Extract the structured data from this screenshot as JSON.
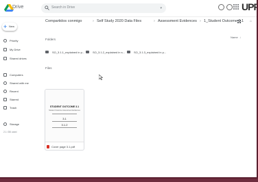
{
  "app": {
    "title": "Drive",
    "brand": "UPF"
  },
  "search": {
    "placeholder": "Search in Drive",
    "options": "▾"
  },
  "sidebar": {
    "new_label": "New",
    "items": [
      {
        "label": "Priority",
        "icon": "check-circle-icon"
      },
      {
        "label": "My Drive",
        "icon": "drive-icon"
      },
      {
        "label": "Shared drives",
        "icon": "shared-drives-icon"
      },
      {
        "label": "Computers",
        "icon": "computer-icon"
      },
      {
        "label": "Shared with me",
        "icon": "people-icon"
      },
      {
        "label": "Recent",
        "icon": "clock-icon"
      },
      {
        "label": "Starred",
        "icon": "star-icon"
      },
      {
        "label": "Trash",
        "icon": "trash-icon"
      },
      {
        "label": "Storage",
        "icon": "cloud-icon"
      }
    ],
    "storage_text": "2.1 GB used"
  },
  "breadcrumb": [
    "Compartidos conmigo",
    "Self Study 2020 Data Files",
    "Assessment Evidences",
    "1_Student Outcome 3.1"
  ],
  "sections": {
    "folders_label": "Folders",
    "files_label": "Files",
    "sort_label": "Name"
  },
  "folders": [
    {
      "name": "SO_3.1.1_explained in p..."
    },
    {
      "name": "SO_3.1.2_explained in s..."
    },
    {
      "name": "SO_3.1.3_explained in p..."
    }
  ],
  "files": [
    {
      "name": "Cover page 3.1.pdf",
      "thumb_title": "STUDENT OUTCOME 3.1",
      "thumb_subtitle": "Student Outcome Assessment Evidences",
      "thumb_value1": "3.1",
      "thumb_value2": "3.1.2"
    }
  ],
  "colors": {
    "accent": "#1a73e8",
    "frame": "#6e2d3e",
    "pdf": "#d93025"
  }
}
